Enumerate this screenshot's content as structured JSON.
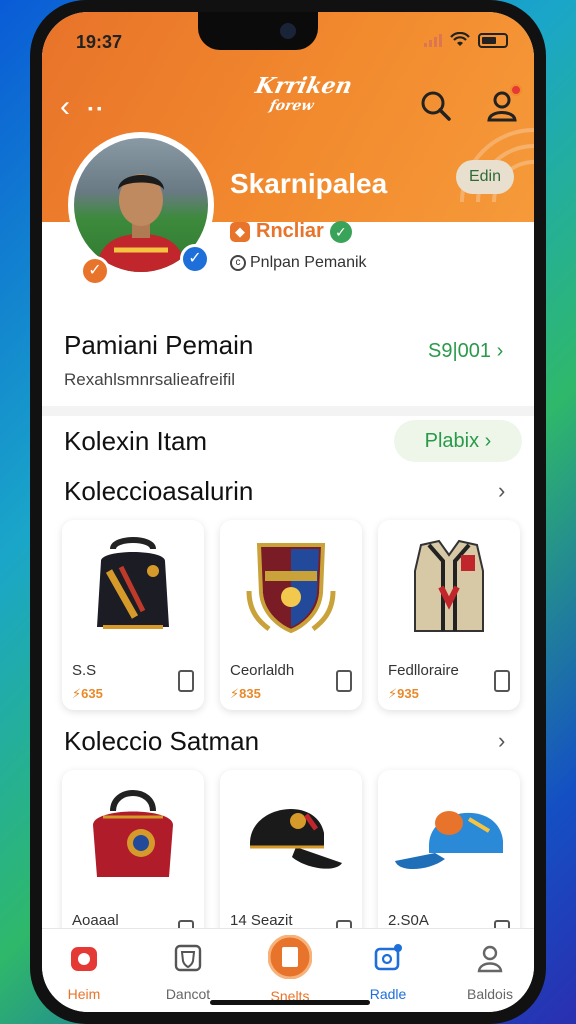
{
  "status": {
    "time": "19:37"
  },
  "header": {
    "logo_line1": "Krriken",
    "logo_line2": "forew"
  },
  "profile": {
    "name": "Skarnipalea",
    "edit_label": "Edin",
    "rank": "Rncliar",
    "position_label": "Pnlpan Pemanik"
  },
  "section1": {
    "title": "Pamiani Pemain",
    "subtitle": "Rexahlsmnrsalieafreifil",
    "link": "S9|001 ›"
  },
  "section2": {
    "title": "Kolexin Itam",
    "pill": "Plabix ›"
  },
  "section3": {
    "title": "Koleccioasalurin",
    "items": [
      {
        "name": "S.S",
        "price": "⚡635"
      },
      {
        "name": "Ceorlaldh",
        "price": "⚡835"
      },
      {
        "name": "Fedlloraire",
        "price": "⚡935"
      }
    ]
  },
  "section4": {
    "title": "Koleccio Satman",
    "items": [
      {
        "name": "Aoaaal",
        "price": ""
      },
      {
        "name": "14 Seazit",
        "price": ""
      },
      {
        "name": "2.S0A",
        "price": ""
      }
    ]
  },
  "nav": [
    "Heim",
    "Dancot",
    "Snelts",
    "Radle",
    "Baldois"
  ],
  "colors": {
    "accent": "#e8732a",
    "green": "#2a9a4a",
    "blue": "#1e6fd9"
  }
}
